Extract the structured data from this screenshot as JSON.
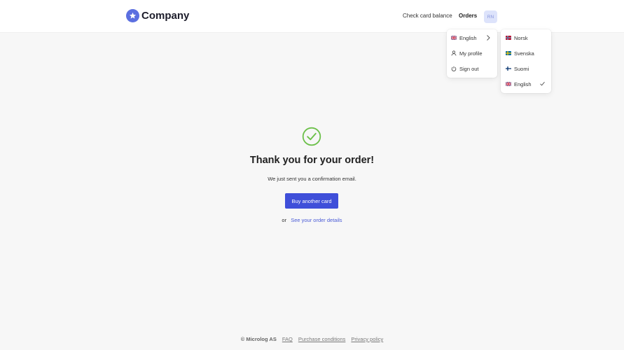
{
  "header": {
    "brand": "Company",
    "nav": {
      "check_card_balance": "Check card balance",
      "orders": "Orders"
    },
    "avatar_initials": "RN"
  },
  "user_menu": {
    "items": [
      {
        "label": "English",
        "icon": "uk-flag-icon"
      },
      {
        "label": "My profile",
        "icon": "user-icon"
      },
      {
        "label": "Sign out",
        "icon": "power-icon"
      }
    ]
  },
  "language_menu": {
    "items": [
      {
        "label": "Norsk",
        "icon": "norway-flag-icon"
      },
      {
        "label": "Svenska",
        "icon": "sweden-flag-icon"
      },
      {
        "label": "Suomi",
        "icon": "finland-flag-icon"
      },
      {
        "label": "English",
        "icon": "uk-flag-icon",
        "selected": true
      }
    ]
  },
  "main": {
    "title": "Thank you for your order!",
    "message": "We just sent you a confirmation email.",
    "primary_button": "Buy another card",
    "or_text": "or",
    "secondary_link": "See your order details"
  },
  "footer": {
    "copyright": "© Microlog AS",
    "links": [
      "FAQ",
      "Purchase conditions",
      "Privacy policy"
    ]
  },
  "colors": {
    "accent": "#3f4fd9",
    "success": "#6cc04a",
    "background": "#f7f7f7"
  }
}
